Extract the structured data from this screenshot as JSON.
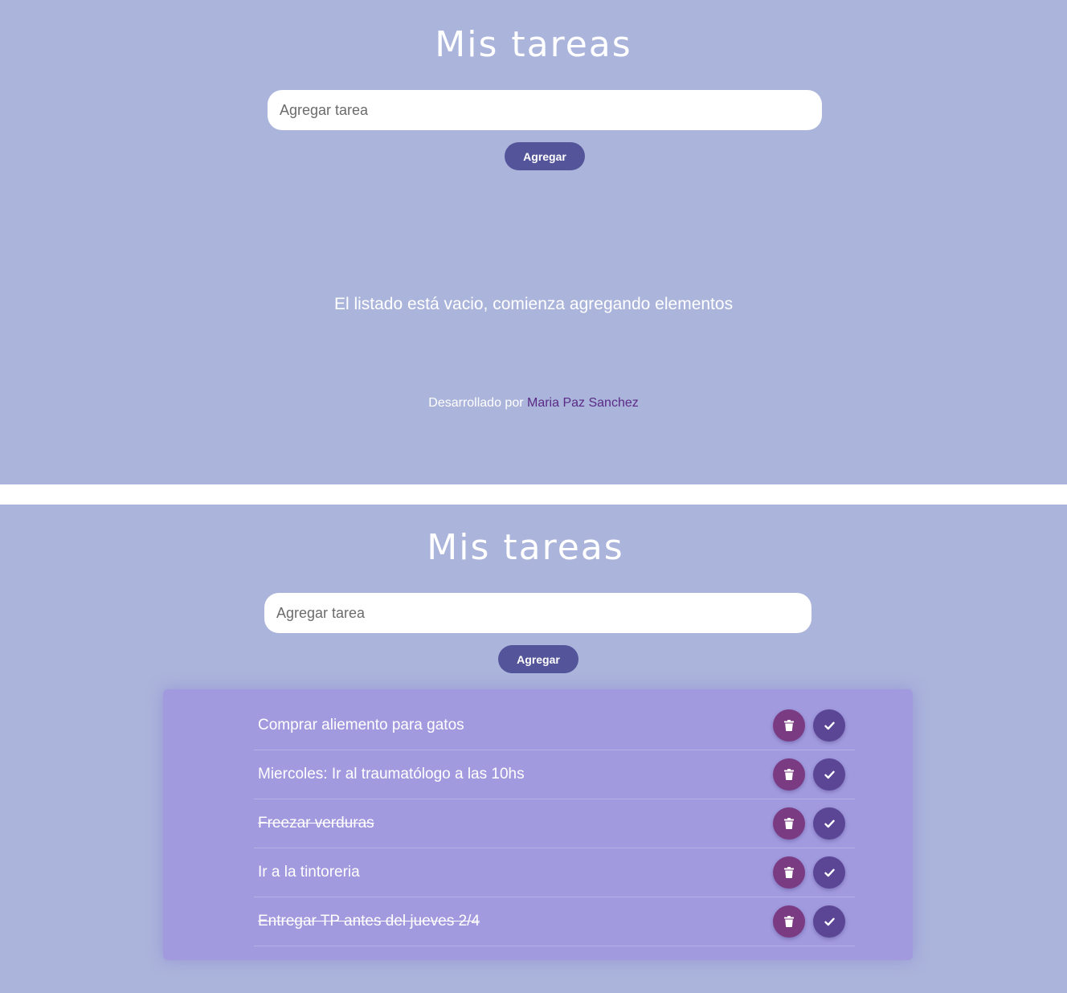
{
  "top": {
    "title": "Mis tareas",
    "input_placeholder": "Agregar tarea",
    "add_label": "Agregar",
    "empty_message": "El listado está vacio, comienza agregando elementos",
    "footer_prefix": "Desarrollado por",
    "footer_author": "Maria Paz Sanchez"
  },
  "bottom": {
    "title": "Mis tareas",
    "input_placeholder": "Agregar tarea",
    "add_label": "Agregar",
    "tasks": [
      {
        "text": "Comprar aliemento para gatos",
        "done": false
      },
      {
        "text": "Miercoles: Ir al traumatólogo a las 10hs",
        "done": false
      },
      {
        "text": "Freezar verduras",
        "done": true
      },
      {
        "text": "Ir a la tintoreria",
        "done": false
      },
      {
        "text": "Entregar TP antes del jueves 2/4",
        "done": true
      }
    ]
  },
  "icons": {
    "delete": "trash-icon",
    "complete": "check-icon"
  },
  "colors": {
    "background": "#abb4db",
    "button": "#54549a",
    "list_card": "#a19ade",
    "delete_button": "#7a3b82",
    "check_button": "#5b4595",
    "author_link": "#5a2a86"
  }
}
